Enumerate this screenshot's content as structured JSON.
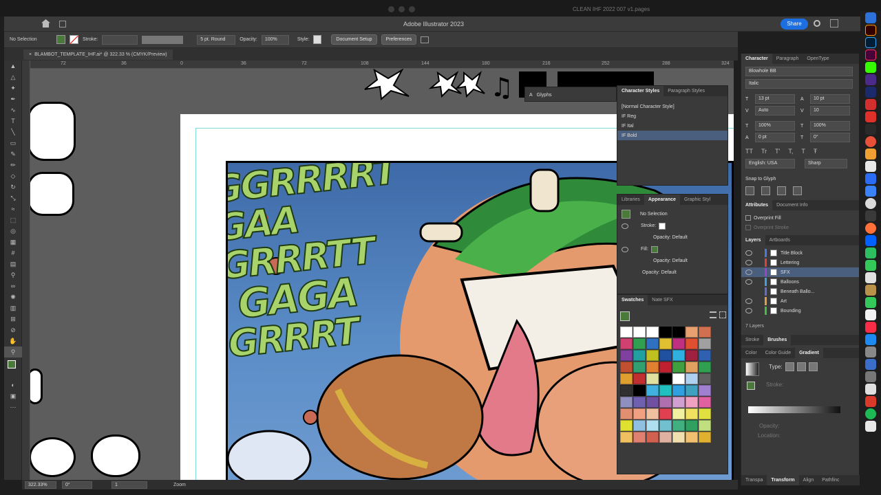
{
  "mac": {
    "doc_title": "CLEAN IHF 2022 007 v1.pages"
  },
  "app": {
    "title": "Adobe Illustrator 2023",
    "share_label": "Share"
  },
  "control": {
    "selection": "No Selection",
    "stroke_label": "Stroke:",
    "brush": "5 pt. Round",
    "opacity_label": "Opacity:",
    "opacity_value": "100%",
    "style_label": "Style:",
    "document_setup": "Document Setup",
    "preferences": "Preferences",
    "fill_color": "#4a7a3a"
  },
  "doc_tab": {
    "label": "BLAMBOT_TEMPLATE_IHF.ai* @ 322.33 % (CMYK/Preview)"
  },
  "ruler": {
    "ticks": [
      "72",
      "36",
      "0",
      "36",
      "72",
      "108",
      "144",
      "180",
      "216",
      "252",
      "288",
      "324"
    ]
  },
  "canvas": {
    "sfx_lines": [
      "GGRRRRT GAA",
      "GRRRTT",
      "GAGA",
      "GRRRT"
    ],
    "sfx_color": "#a8d26a"
  },
  "status": {
    "zoom": "322.33%",
    "rotate": "0°",
    "artboard": "1",
    "tool": "Zoom"
  },
  "glyphs": {
    "label": "Glyphs"
  },
  "char_styles": {
    "tabs": [
      "Character Styles",
      "Paragraph Styles"
    ],
    "items": [
      "[Normal Character Style]",
      "IF Reg",
      "IF Ital",
      "IF Bold"
    ],
    "selected": 3
  },
  "appearance": {
    "tabs": [
      "Libraries",
      "Appearance",
      "Graphic Styl"
    ],
    "selection": "No Selection",
    "rows": [
      {
        "label": "Stroke:",
        "indent": 0
      },
      {
        "label": "Opacity: Default",
        "indent": 1
      },
      {
        "label": "Fill:",
        "indent": 0
      },
      {
        "label": "Opacity: Default",
        "indent": 1
      },
      {
        "label": "Opacity: Default",
        "indent": 0
      }
    ]
  },
  "swatches": {
    "tabs": [
      "Swatches",
      "Nate SFX"
    ],
    "colors": [
      "#ffffff",
      "#ffffff",
      "#ffffff",
      "#000000",
      "#000000",
      "#e8a070",
      "#d07050",
      "#d04070",
      "#30a050",
      "#3070c0",
      "#e0c030",
      "#c03080",
      "#e05030",
      "#a0a0a0",
      "#8040a0",
      "#20a0a0",
      "#c0c020",
      "#2050a0",
      "#30b0e0",
      "#a02040",
      "#3060b0",
      "#c05030",
      "#30a070",
      "#e08030",
      "#c02030",
      "#40a040",
      "#e0a060",
      "#30a050",
      "#e0a030",
      "#c03030",
      "#e0e0a0",
      "#000000",
      "#ffffff",
      "#b0d0f0",
      "#606060",
      "#303030",
      "#000000",
      "#40b0e0",
      "#20c0c0",
      "#30a0e0",
      "#40a0c0",
      "#a080d0",
      "#9090c0",
      "#7060b0",
      "#7050a0",
      "#b070b0",
      "#d0a0d0",
      "#f0a0c0",
      "#e060a0",
      "#e09070",
      "#f0a080",
      "#f0c0a0",
      "#e04050",
      "#f0f0a0",
      "#f0e060",
      "#e0e040",
      "#e0e030",
      "#90c0e0",
      "#b0e0f0",
      "#70c0d0",
      "#40b080",
      "#30a060",
      "#c0e080",
      "#f0c060",
      "#e08070",
      "#d06050",
      "#e0b0a0",
      "#f0e0b0",
      "#f0c070",
      "#e0b030"
    ]
  },
  "character": {
    "tabs": [
      "Character",
      "Paragraph",
      "OpenType"
    ],
    "font": "Blowhole BB",
    "style": "Italic",
    "size": "13 pt",
    "leading": "10 pt",
    "kerning": "Auto",
    "tracking": "10",
    "v_scale": "100%",
    "h_scale": "100%",
    "baseline": "0 pt",
    "rotation": "0°",
    "language": "English: USA",
    "aa": "Sharp",
    "snap": "Snap to Glyph"
  },
  "attributes": {
    "tabs": [
      "Attributes",
      "Document Info"
    ],
    "overprint_fill": "Overprint Fill",
    "overprint_stroke": "Overprint Stroke"
  },
  "layers": {
    "tabs": [
      "Layers",
      "Artboards"
    ],
    "items": [
      {
        "name": "Title Block",
        "color": "#4a7ae0"
      },
      {
        "name": "Lettering",
        "color": "#e04040"
      },
      {
        "name": "SFX",
        "color": "#a040d0"
      },
      {
        "name": "Balloons",
        "color": "#40a0e0"
      },
      {
        "name": "Beneath Ballo...",
        "color": "#6070d0"
      },
      {
        "name": "Art",
        "color": "#e0a040"
      },
      {
        "name": "Bounding",
        "color": "#40c040"
      }
    ],
    "selected": 2,
    "count": "7 Layers"
  },
  "stroke_brushes": {
    "tabs": [
      "Stroke",
      "Brushes"
    ]
  },
  "gradient": {
    "tabs": [
      "Color",
      "Color Guide",
      "Gradient"
    ],
    "type_label": "Type:",
    "stroke_label": "Stroke:",
    "opacity_label": "Opacity:",
    "location_label": "Location:"
  },
  "bottom_tabs": [
    "Transpa",
    "Transform",
    "Align",
    "Pathfinc"
  ]
}
